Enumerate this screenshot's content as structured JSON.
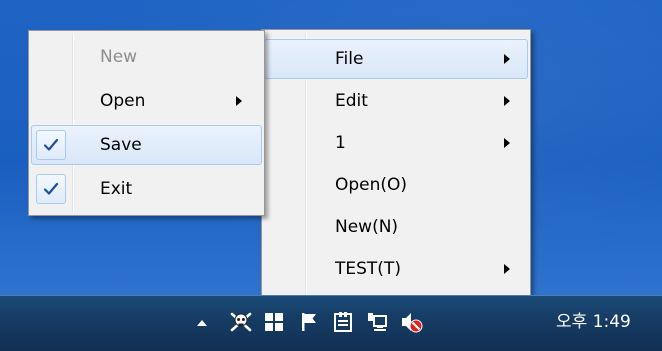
{
  "tray_menu": {
    "items": [
      {
        "label": "File",
        "has_submenu": true,
        "highlighted": true
      },
      {
        "label": "Edit",
        "has_submenu": true
      },
      {
        "label": "1",
        "has_submenu": true
      },
      {
        "label": "Open(O)",
        "has_submenu": false
      },
      {
        "label": "New(N)",
        "has_submenu": false
      },
      {
        "label": "TEST(T)",
        "has_submenu": true
      }
    ]
  },
  "file_submenu": {
    "items": [
      {
        "label": "New",
        "disabled": true
      },
      {
        "label": "Open",
        "has_submenu": true
      },
      {
        "label": "Save",
        "checked": true,
        "highlighted": true
      },
      {
        "label": "Exit",
        "checked": true
      }
    ]
  },
  "taskbar": {
    "tray_icons": [
      "show-hidden-icons-arrow",
      "app-skull-crossbones-icon",
      "windows-grid-icon",
      "action-center-flag-icon",
      "device-usb-icon",
      "network-computer-icon",
      "volume-muted-icon"
    ],
    "clock": "오후 1:49"
  },
  "colors": {
    "desktop": "#1f64c4",
    "taskbar": "#163b63",
    "menu_background": "#f1f1f1",
    "highlight": "#d9e7f9",
    "check": "#1a4ea8"
  }
}
